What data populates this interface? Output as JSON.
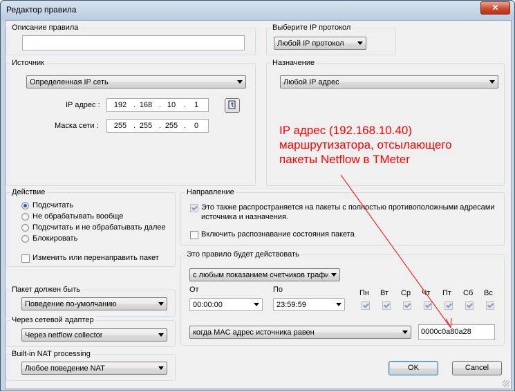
{
  "window": {
    "title": "Редактор правила",
    "close_glyph": "✕"
  },
  "rule_description": {
    "label": "Описание правила",
    "value": ""
  },
  "protocol": {
    "label": "Выберите IP протокол",
    "selected": "Любой IP протокол"
  },
  "source": {
    "label": "Источник",
    "type_selected": "Определенная IP сеть",
    "ip_label": "IP адрес :",
    "ip": [
      "192",
      "168",
      "10",
      "1"
    ],
    "mask_label": "Маска сети :",
    "mask": [
      "255",
      "255",
      "255",
      "0"
    ]
  },
  "destination": {
    "label": "Назначение",
    "selected": "Любой IP адрес"
  },
  "annotation": {
    "lines": [
      "IP адрес (192.168.10.40)",
      "маршрутизатора, отсылающего",
      "пакеты Netflow в TMeter"
    ],
    "color": "#ff0000"
  },
  "action": {
    "label": "Действие",
    "options": [
      "Подсчитать",
      "Не обрабатывать вообще",
      "Подсчитать и не обрабатывать далее",
      "Блокировать"
    ],
    "selected_index": 0,
    "redirect_label": "Изменить или перенаправить пакет",
    "redirect_checked": false
  },
  "direction": {
    "label": "Направление",
    "opposite_label_1": "Это также распространяется на пакеты с полностью противоположными адресами",
    "opposite_label_2": "источника и назначения.",
    "opposite_checked": true,
    "state_label": "Включить распознавание состояния пакета",
    "state_checked": false
  },
  "schedule": {
    "label": "Это правило будет действовать",
    "mode_selected": "с любым показанием счетчиков трафи",
    "from_label": "От",
    "from_value": "00:00:00",
    "to_label": "По",
    "to_value": "23:59:59",
    "days": [
      "Пн",
      "Вт",
      "Ср",
      "Чт",
      "Пт",
      "Сб",
      "Вс"
    ],
    "mac_condition": "когда MAC адрес источника равен",
    "mac_value": "0000c0a80a28"
  },
  "packet_must_be": {
    "label": "Пакет должен быть",
    "selected": "Поведение по-умолчанию"
  },
  "adapter": {
    "label": "Через сетевой адаптер",
    "selected": "Через netflow collector"
  },
  "nat": {
    "label": "Built-in NAT processing",
    "selected": "Любое поведение NAT"
  },
  "buttons": {
    "ok": "OK",
    "cancel": "Cancel"
  }
}
